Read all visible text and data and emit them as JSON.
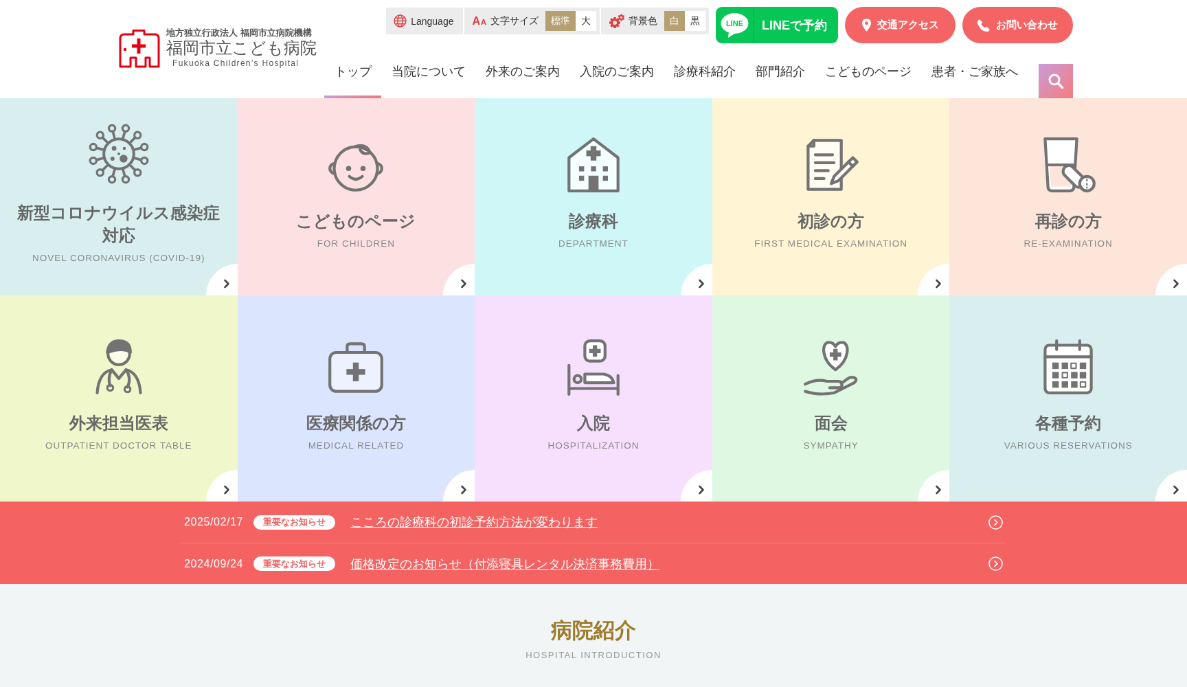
{
  "header": {
    "logo": {
      "organization": "地方独立行政法人 福岡市立病院機構",
      "name": "福岡市立こども病院",
      "english_name": "Fukuoka Children’s Hospital"
    },
    "utility": {
      "language": {
        "label": "Language"
      },
      "font_size": {
        "icon_glyphs": [
          "A",
          "A"
        ],
        "label": "文字サイズ",
        "options": [
          {
            "label": "標準",
            "selected": true
          },
          {
            "label": "大",
            "selected": false
          }
        ]
      },
      "background": {
        "label": "背景色",
        "options": [
          {
            "label": "白",
            "selected": true
          },
          {
            "label": "黒",
            "selected": false
          }
        ]
      }
    },
    "buttons": [
      {
        "kind": "line",
        "logo_text": "LINE",
        "label": "LINEで予約"
      },
      {
        "kind": "access",
        "label": "交通アクセス"
      },
      {
        "kind": "contact",
        "label": "お問い合わせ"
      }
    ],
    "nav": [
      {
        "label": "トップ",
        "selected": true
      },
      {
        "label": "当院について",
        "selected": false
      },
      {
        "label": "外来のご案内",
        "selected": false
      },
      {
        "label": "入院のご案内",
        "selected": false
      },
      {
        "label": "診療科紹介",
        "selected": false
      },
      {
        "label": "部門紹介",
        "selected": false
      },
      {
        "label": "こどものページ",
        "selected": false
      },
      {
        "label": "患者・ご家族へ",
        "selected": false
      }
    ]
  },
  "tiles": [
    {
      "kind": "virus",
      "title": "新型コロナウイルス感染症対応",
      "subtitle": "NOVEL CORONAVIRUS (COVID-19)",
      "color": "#d9efef"
    },
    {
      "kind": "child",
      "title": "こどものページ",
      "subtitle": "FOR CHILDREN",
      "color": "#fde1e2"
    },
    {
      "kind": "clinic",
      "title": "診療科",
      "subtitle": "DEPARTMENT",
      "color": "#cff7f7"
    },
    {
      "kind": "document",
      "title": "初診の方",
      "subtitle": "FIRST MEDICAL EXAMINATION",
      "color": "#fff5d5"
    },
    {
      "kind": "medicine",
      "title": "再診の方",
      "subtitle": "RE-EXAMINATION",
      "color": "#fde5da"
    },
    {
      "kind": "doctor",
      "title": "外来担当医表",
      "subtitle": "OUTPATIENT DOCTOR TABLE",
      "color": "#f0f7cb"
    },
    {
      "kind": "kit",
      "title": "医療関係の方",
      "subtitle": "MEDICAL RELATED",
      "color": "#dbe5fe"
    },
    {
      "kind": "bed",
      "title": "入院",
      "subtitle": "HOSPITALIZATION",
      "color": "#f7e0fe"
    },
    {
      "kind": "heart",
      "title": "面会",
      "subtitle": "SYMPATHY",
      "color": "#dff8e1"
    },
    {
      "kind": "calendar",
      "title": "各種予約",
      "subtitle": "VARIOUS RESERVATIONS",
      "color": "#d9efef"
    }
  ],
  "news": [
    {
      "date": "2025/02/17",
      "badge": "重要なお知らせ",
      "title": "こころの診療科の初診予約方法が変わります"
    },
    {
      "date": "2024/09/24",
      "badge": "重要なお知らせ",
      "title": "価格改定のお知らせ（付添寝具レンタル決済事務費用）"
    }
  ],
  "introduction": {
    "title": "病院紹介",
    "subtitle": "HOSPITAL INTRODUCTION"
  }
}
